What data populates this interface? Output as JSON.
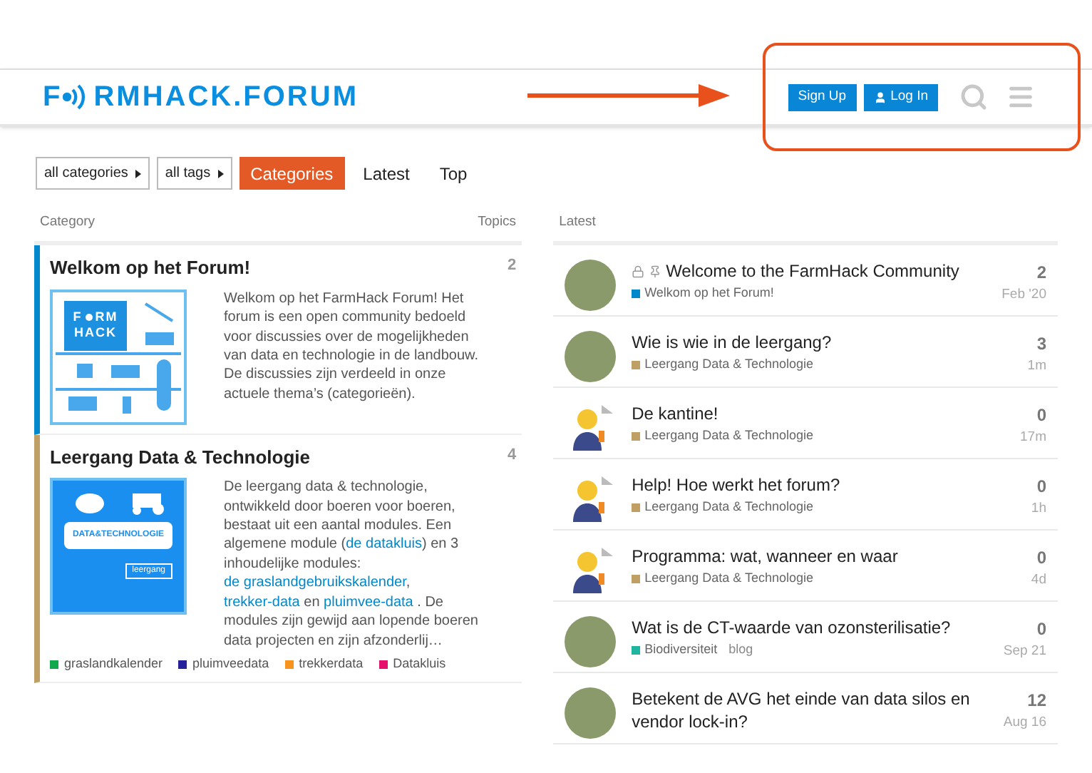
{
  "header": {
    "logo_start": "F",
    "logo_end": "RMHACK.FORUM",
    "buttons": [
      {
        "label": "Sign Up",
        "kind": "plain"
      },
      {
        "label": "Log In",
        "kind": "user"
      }
    ]
  },
  "filters": {
    "dropdowns": [
      "all categories",
      "all tags"
    ],
    "tabs": [
      {
        "label": "Categories",
        "selected": true
      },
      {
        "label": "Latest",
        "selected": false
      },
      {
        "label": "Top",
        "selected": false
      }
    ]
  },
  "categories_table": {
    "columns": [
      "Category",
      "Topics"
    ],
    "rows": [
      {
        "name": "Welkom op het Forum!",
        "color": "#0088cc",
        "topics": "2",
        "kind": "farmhack",
        "image_text": [
          "F",
          "RM",
          "HACK"
        ],
        "description": [
          {
            "text": "Welkom op het FarmHack Forum! Het forum is een open community bedoeld voor discussies over de mogelijkheden van data en technologie in de landbouw. De discussies zijn verdeeld in onze actuele thema’s (categorieën).",
            "link": false
          }
        ],
        "tags": []
      },
      {
        "name": "Leergang Data & Technologie",
        "color": "#bf9f64",
        "topics": "4",
        "kind": "leergang",
        "image_text": [
          "DATA&TECHNOLOGIE",
          "leergang"
        ],
        "description": [
          {
            "text": "De leergang data & technologie, ontwikkeld door boeren voor boeren, bestaat uit een aantal modules. Een algemene module (",
            "link": false
          },
          {
            "text": "de datakluis",
            "link": true
          },
          {
            "text": ") en 3 inhoudelijke modules: ",
            "link": false
          },
          {
            "text": "de graslandgebruikskalender",
            "link": true
          },
          {
            "text": ", ",
            "link": false
          },
          {
            "text": "trekker-data",
            "link": true
          },
          {
            "text": " en ",
            "link": false
          },
          {
            "text": "pluimvee-data",
            "link": true
          },
          {
            "text": " . De modules zijn gewijd aan lopende boeren data projecten en zijn afzonderlij…",
            "link": false
          }
        ],
        "tags": [
          {
            "label": "graslandkalender",
            "color": "#12a94c"
          },
          {
            "label": "pluimveedata",
            "color": "#25229a"
          },
          {
            "label": "trekkerdata",
            "color": "#f7941d"
          },
          {
            "label": "Datakluis",
            "color": "#e60f6c"
          }
        ]
      }
    ]
  },
  "latest": {
    "heading": "Latest",
    "topics": [
      {
        "title": "Welcome to the FarmHack Community",
        "closed": true,
        "pinned": true,
        "category": "Welkom op het Forum!",
        "color": "#0088cc",
        "replies": "2",
        "time": "Feb '20",
        "kind": "photo"
      },
      {
        "title": "Wie is wie in de leergang?",
        "closed": false,
        "pinned": false,
        "category": "Leergang Data & Technologie",
        "color": "#bf9f64",
        "replies": "3",
        "time": "1m",
        "kind": "photo"
      },
      {
        "title": "De kantine!",
        "closed": false,
        "pinned": false,
        "category": "Leergang Data & Technologie",
        "color": "#bf9f64",
        "replies": "0",
        "time": "17m",
        "kind": "cartoon"
      },
      {
        "title": "Help! Hoe werkt het forum?",
        "closed": false,
        "pinned": false,
        "category": "Leergang Data & Technologie",
        "color": "#bf9f64",
        "replies": "0",
        "time": "1h",
        "kind": "cartoon"
      },
      {
        "title": "Programma: wat, wanneer en waar",
        "closed": false,
        "pinned": false,
        "category": "Leergang Data & Technologie",
        "color": "#bf9f64",
        "replies": "0",
        "time": "4d",
        "kind": "cartoon"
      },
      {
        "title": "Wat is de CT-waarde van ozonsterilisatie?",
        "closed": false,
        "pinned": false,
        "category": "Biodiversiteit",
        "color": "#1fb5a0",
        "tag": "blog",
        "replies": "0",
        "time": "Sep 21",
        "kind": "photo"
      },
      {
        "title": "Betekent de AVG het einde van data silos en vendor lock-in?",
        "closed": false,
        "pinned": false,
        "replies": "12",
        "time": "Aug 16",
        "kind": "photo"
      }
    ]
  }
}
